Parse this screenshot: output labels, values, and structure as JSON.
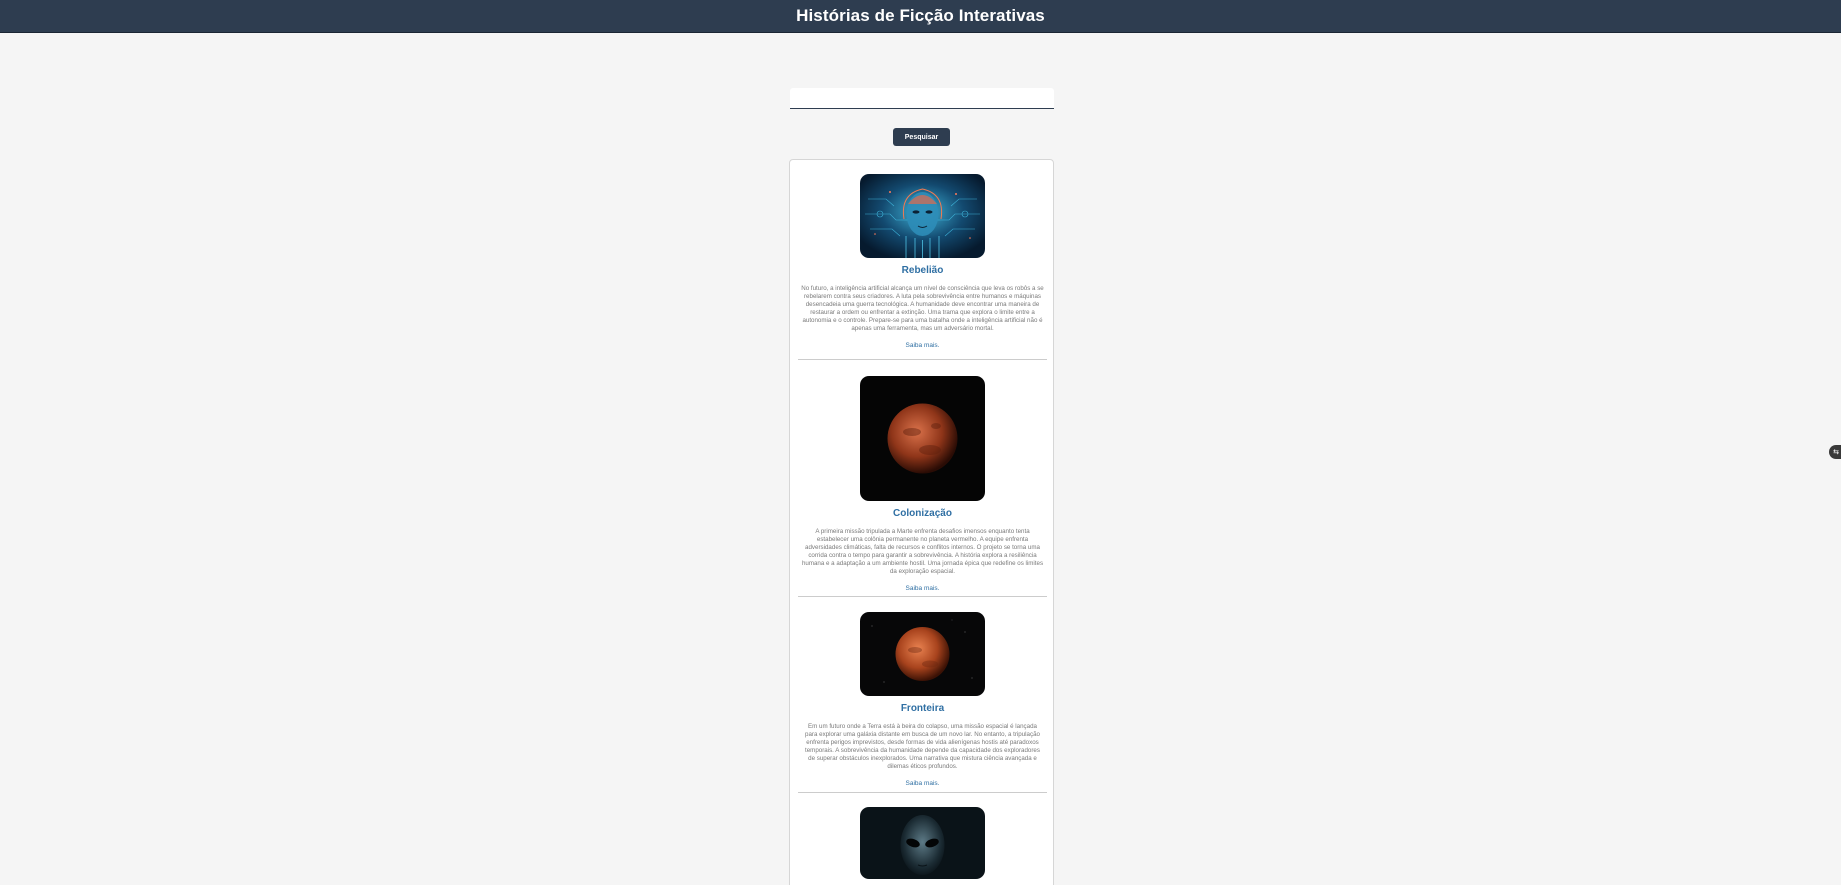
{
  "header": {
    "title": "Histórias de Ficção Interativas"
  },
  "search": {
    "value": "",
    "placeholder": "",
    "button_label": "Pesquisar"
  },
  "stories": [
    {
      "title": "Rebelião",
      "image": "robot-face-image",
      "description": "No futuro, a inteligência artificial alcança um nível de consciência que leva os robôs a se rebelarem contra seus criadores. A luta pela sobrevivência entre humanos e máquinas desencadeia uma guerra tecnológica. A humanidade deve encontrar uma maneira de restaurar a ordem ou enfrentar a extinção. Uma trama que explora o limite entre a autonomia e o controle. Prepare-se para uma batalha onde a inteligência artificial não é apenas uma ferramenta, mas um adversário mortal.",
      "link_label": "Saiba mais."
    },
    {
      "title": "Colonização",
      "image": "mars-planet-image",
      "description": "A primeira missão tripulada a Marte enfrenta desafios imensos enquanto tenta estabelecer uma colônia permanente no planeta vermelho. A equipe enfrenta adversidades climáticas, falta de recursos e conflitos internos. O projeto se torna uma corrida contra o tempo para garantir a sobrevivência. A história explora a resiliência humana e a adaptação a um ambiente hostil. Uma jornada épica que redefine os limites da exploração espacial.",
      "link_label": "Saiba mais."
    },
    {
      "title": "Fronteira",
      "image": "red-planet-image",
      "description": "Em um futuro onde a Terra está à beira do colapso, uma missão espacial é lançada para explorar uma galáxia distante em busca de um novo lar. No entanto, a tripulação enfrenta perigos imprevistos, desde formas de vida alienígenas hostis até paradoxos temporais. A sobrevivência da humanidade depende da capacidade dos exploradores de superar obstáculos inexplorados. Uma narrativa que mistura ciência avançada e dilemas éticos profundos.",
      "link_label": "Saiba mais."
    },
    {
      "title": "",
      "image": "alien-face-image",
      "description": "",
      "link_label": ""
    }
  ],
  "colors": {
    "header_bg": "#2e3d50",
    "accent": "#2f6fa3",
    "page_bg": "#f5f5f5"
  }
}
